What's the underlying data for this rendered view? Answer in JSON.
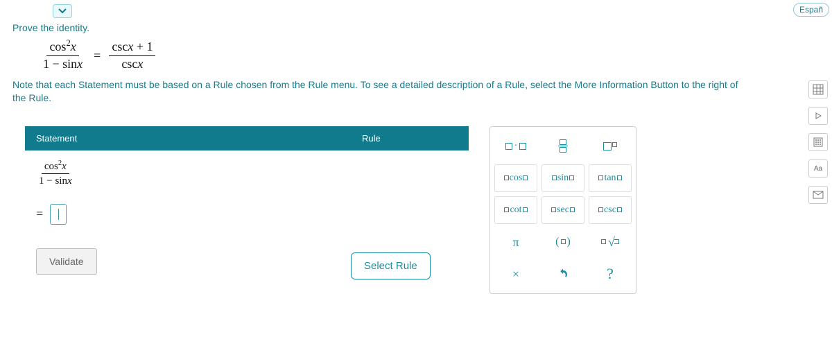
{
  "lang_label": "Españ",
  "prompt": "Prove the identity.",
  "equation": {
    "lhs_num": "cos²x",
    "lhs_den": "1 − sinx",
    "rhs_num": "cscx + 1",
    "rhs_den": "cscx"
  },
  "note": "Note that each Statement must be based on a Rule chosen from the Rule menu. To see a detailed description of a Rule, select the More Information Button to the right of the Rule.",
  "headers": {
    "statement": "Statement",
    "rule": "Rule"
  },
  "initial_statement": {
    "num": "cos²x",
    "den": "1 − sinx"
  },
  "buttons": {
    "select_rule": "Select Rule",
    "validate": "Validate"
  },
  "palette": {
    "row1": [
      "mult",
      "frac",
      "exp"
    ],
    "row2": [
      "cos",
      "sin",
      "tan"
    ],
    "row3": [
      "cot",
      "sec",
      "csc"
    ],
    "row4_pi": "π",
    "row5": [
      "clear",
      "undo",
      "help"
    ]
  },
  "sidebar": [
    "grid-icon",
    "play-icon",
    "keypad-icon",
    "aa-icon",
    "mail-icon"
  ]
}
